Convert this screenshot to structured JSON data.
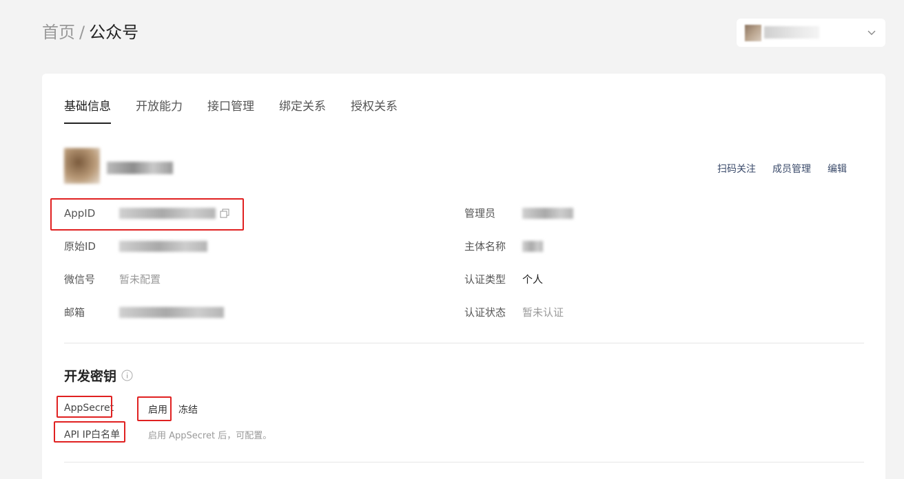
{
  "breadcrumb": {
    "home": "首页",
    "separator": "/",
    "current": "公众号"
  },
  "tabs": [
    "基础信息",
    "开放能力",
    "接口管理",
    "绑定关系",
    "授权关系"
  ],
  "actions": {
    "scan_follow": "扫码关注",
    "member_manage": "成员管理",
    "edit": "编辑"
  },
  "info": {
    "appid_label": "AppID",
    "original_id_label": "原始ID",
    "wechat_label": "微信号",
    "wechat_value": "暂未配置",
    "email_label": "邮箱",
    "admin_label": "管理员",
    "entity_label": "主体名称",
    "cert_type_label": "认证类型",
    "cert_type_value": "个人",
    "cert_status_label": "认证状态",
    "cert_status_value": "暂未认证"
  },
  "dev_key": {
    "title": "开发密钥",
    "appsecret_label": "AppSecret",
    "enable": "启用",
    "freeze": "冻结",
    "ip_whitelist_label": "API IP白名单",
    "ip_whitelist_hint": "启用 AppSecret 后，可配置。"
  }
}
